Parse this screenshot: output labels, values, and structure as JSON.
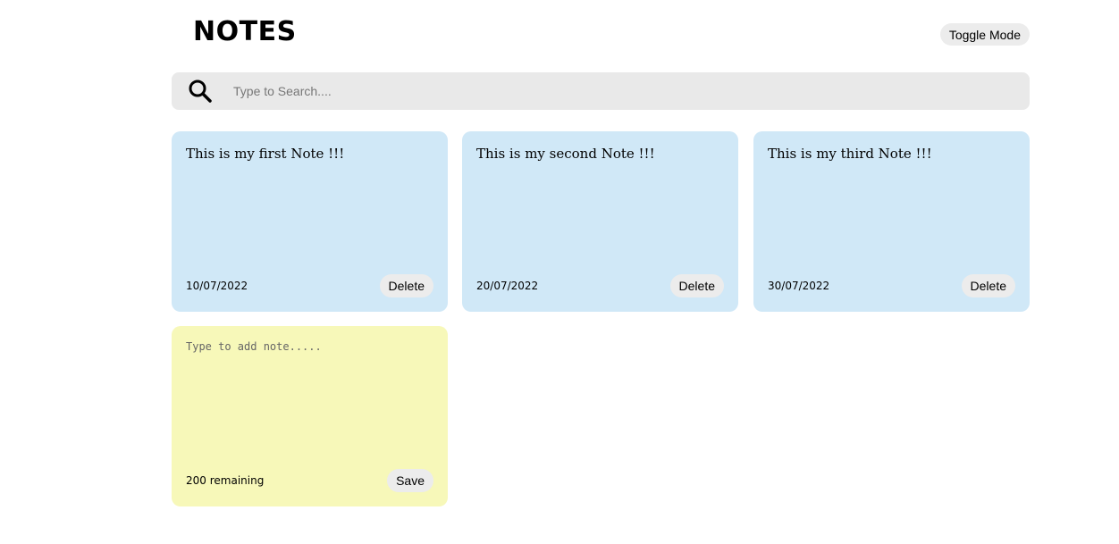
{
  "header": {
    "title": "NOTES",
    "toggle_label": "Toggle Mode"
  },
  "search": {
    "icon": "search-icon",
    "placeholder": "Type to Search....",
    "value": ""
  },
  "notes": [
    {
      "text": "This is my first Note !!!",
      "date": "10/07/2022",
      "delete_label": "Delete"
    },
    {
      "text": "This is my second Note !!!",
      "date": "20/07/2022",
      "delete_label": "Delete"
    },
    {
      "text": "This is my third Note !!!",
      "date": "30/07/2022",
      "delete_label": "Delete"
    }
  ],
  "new_note": {
    "placeholder": "Type to add note.....",
    "value": "",
    "remaining_text": "200 remaining",
    "save_label": "Save"
  },
  "colors": {
    "note_background": "#d0e8f7",
    "new_note_background": "#f7f8b9",
    "search_background": "#e9e9e9",
    "button_background": "#ececec"
  }
}
